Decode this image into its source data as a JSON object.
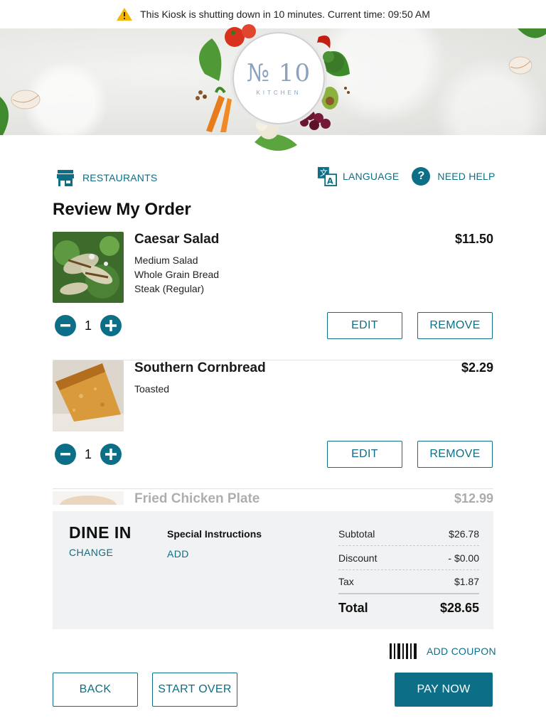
{
  "alert": {
    "message": "This Kiosk is shutting down in 10 minutes. Current time: 09:50 AM",
    "color": "#f2b705"
  },
  "brand": {
    "logo_main": "№ 10",
    "logo_sub": "KITCHEN"
  },
  "nav": {
    "restaurants": "RESTAURANTS",
    "language": "LANGUAGE",
    "need_help": "NEED HELP",
    "help_glyph": "?"
  },
  "page": {
    "title": "Review My Order"
  },
  "order": {
    "items": [
      {
        "name": "Caesar Salad",
        "price": "$11.50",
        "modifiers": [
          "Medium Salad",
          "Whole Grain Bread",
          "Steak (Regular)"
        ],
        "quantity": "1",
        "edit_label": "EDIT",
        "remove_label": "REMOVE",
        "image": "caesar-salad-photo"
      },
      {
        "name": "Southern Cornbread",
        "price": "$2.29",
        "modifiers": [
          "Toasted"
        ],
        "quantity": "1",
        "edit_label": "EDIT",
        "remove_label": "REMOVE",
        "image": "cornbread-photo"
      },
      {
        "name": "Fried Chicken Plate",
        "price": "$12.99",
        "image": "fried-chicken-photo"
      }
    ],
    "qty_minus": "−",
    "qty_plus": "+"
  },
  "summary": {
    "dine_mode": "DINE IN",
    "change_label": "CHANGE",
    "special_title": "Special Instructions",
    "special_add": "ADD",
    "rows": [
      {
        "label": "Subtotal",
        "value": "$26.78"
      },
      {
        "label": "Discount",
        "value": "- $0.00"
      },
      {
        "label": "Tax",
        "value": "$1.87"
      }
    ],
    "total_label": "Total",
    "total_value": "$28.65"
  },
  "coupon": {
    "label": "ADD COUPON",
    "icon": "barcode-icon"
  },
  "actions": {
    "back": "BACK",
    "start_over": "START OVER",
    "pay_now": "PAY NOW"
  },
  "colors": {
    "accent": "#0d6e87",
    "panel": "#f1f2f3"
  }
}
